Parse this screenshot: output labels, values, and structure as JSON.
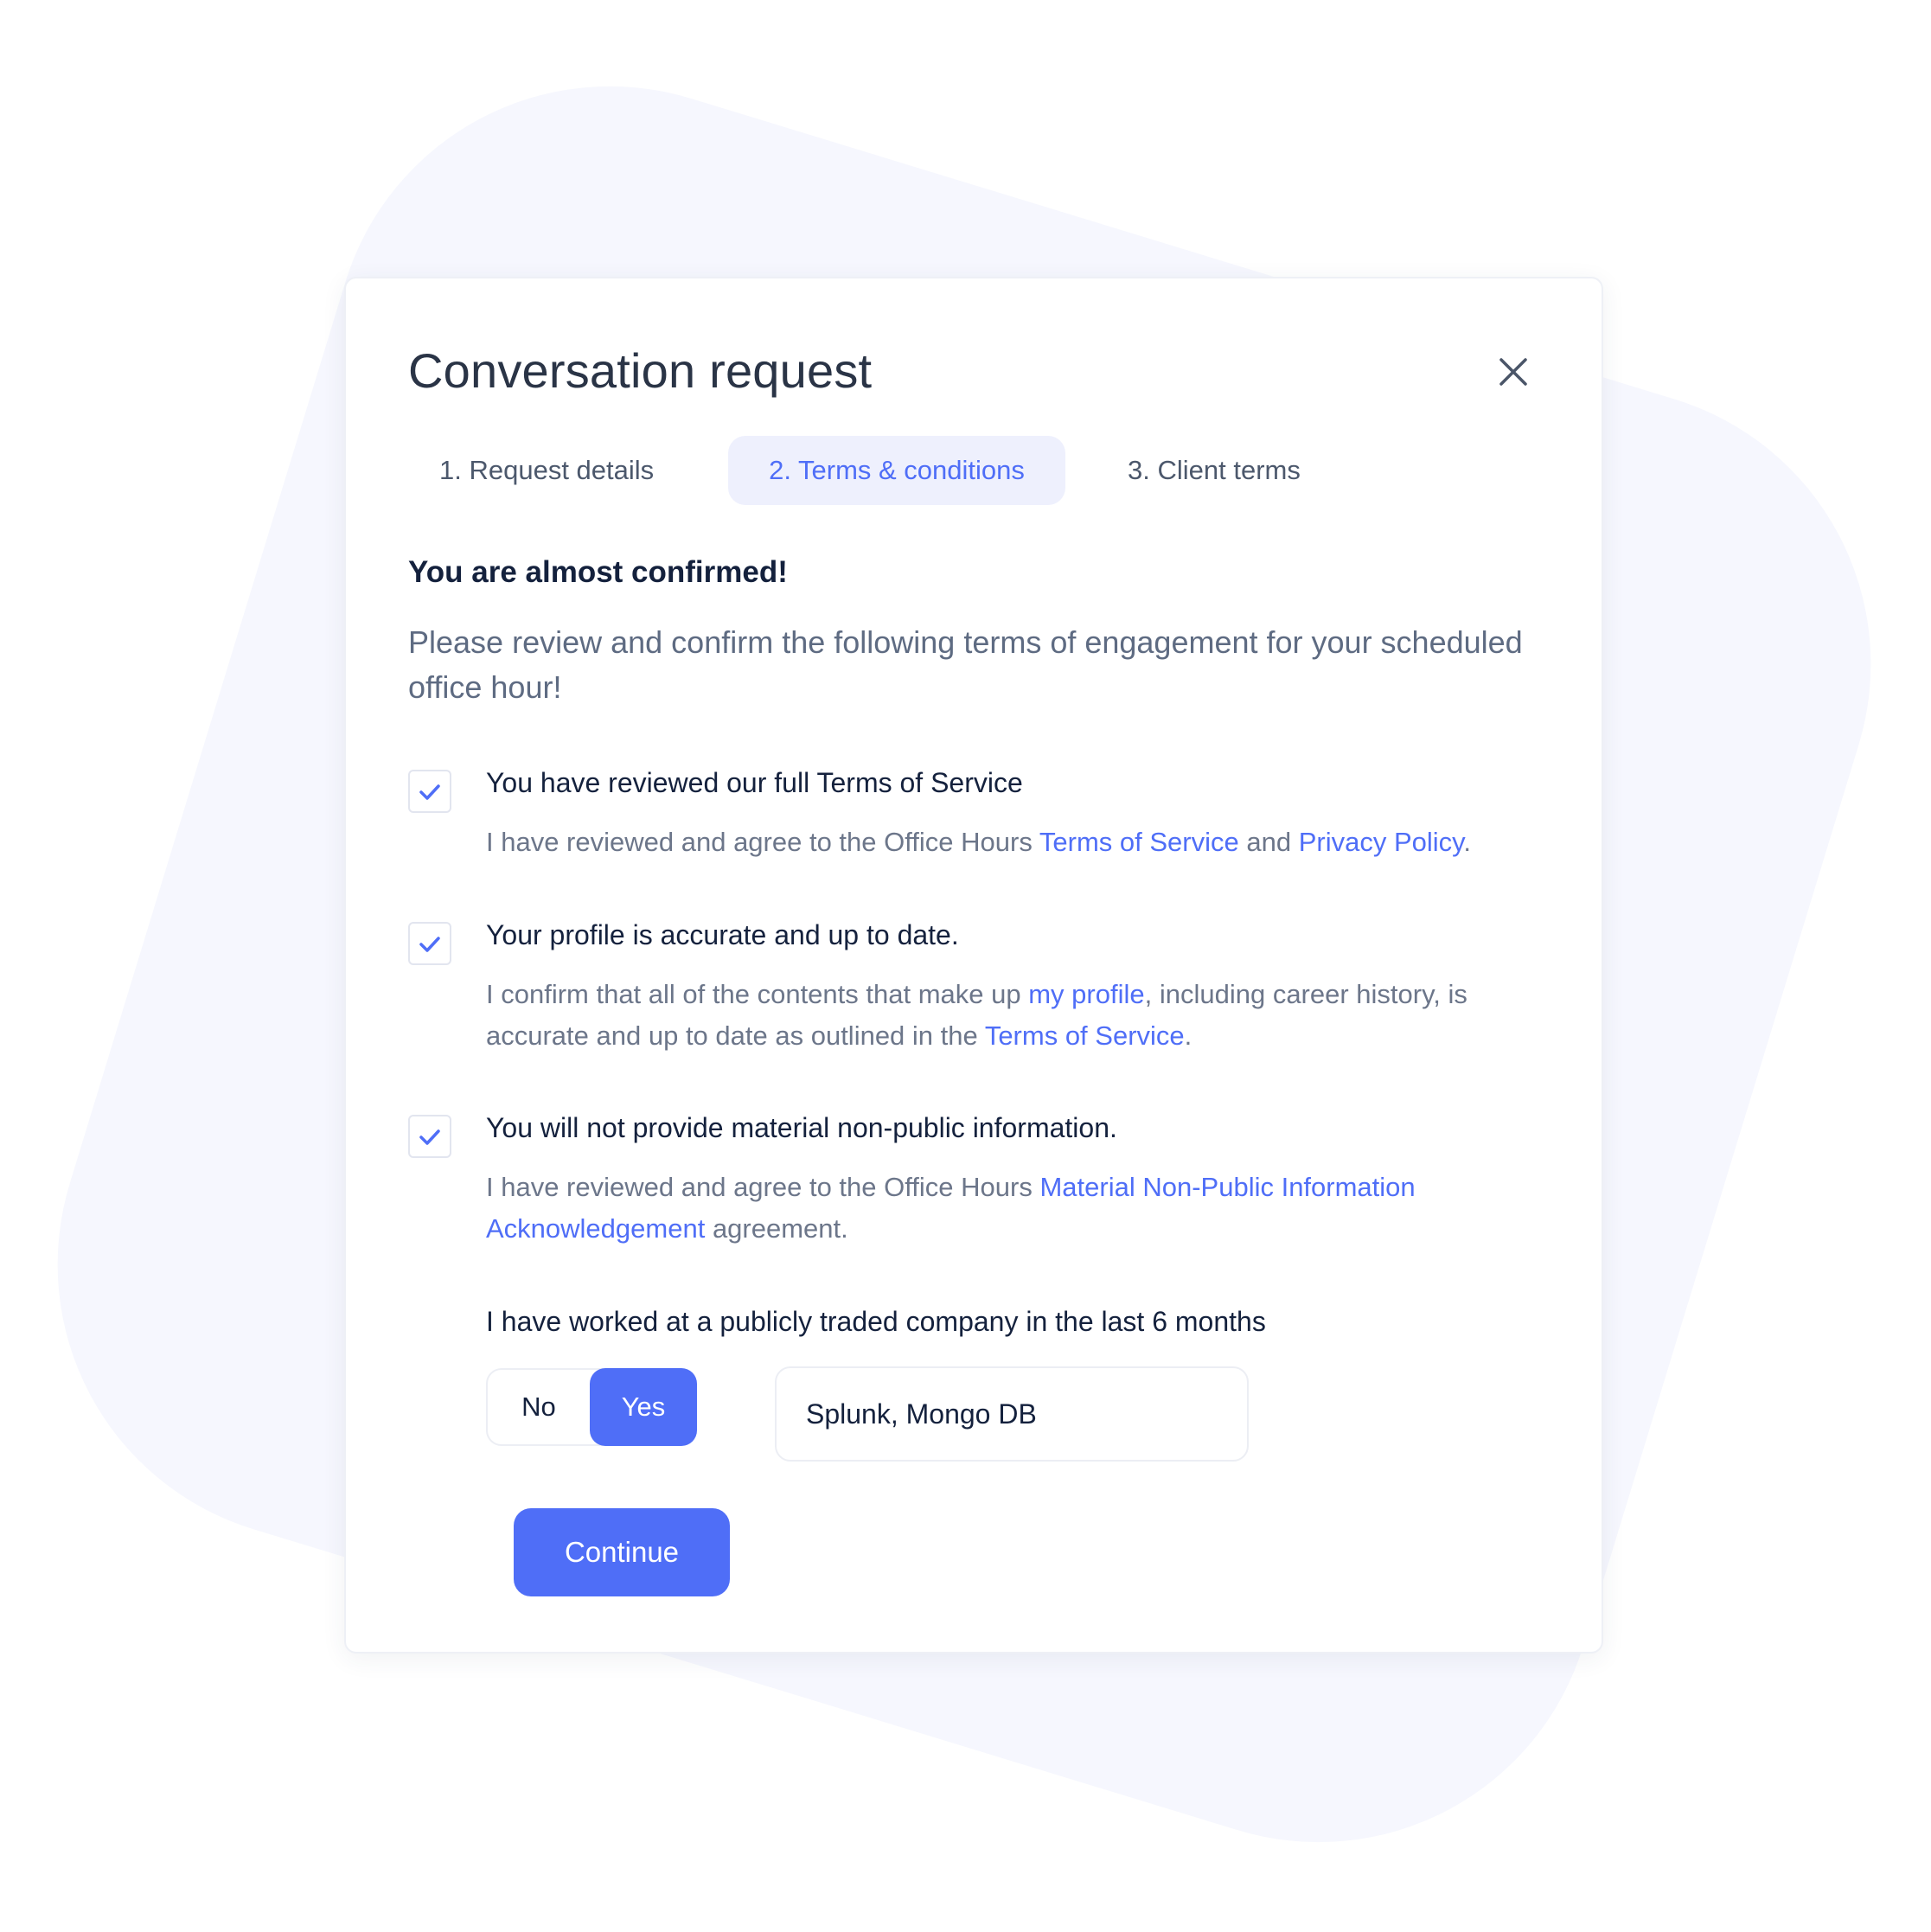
{
  "modal": {
    "title": "Conversation request",
    "close_icon": "close-icon"
  },
  "tabs": [
    {
      "label": "1. Request details",
      "active": false
    },
    {
      "label": "2. Terms & conditions",
      "active": true
    },
    {
      "label": "3. Client terms",
      "active": false
    }
  ],
  "content": {
    "subheading": "You are almost confirmed!",
    "intro": "Please review and confirm the following terms of engagement for your scheduled office hour!"
  },
  "terms": [
    {
      "checked": true,
      "title": "You have reviewed our full Terms of Service",
      "desc_parts": [
        "I have reviewed and agree to the Office Hours ",
        " and ",
        "."
      ],
      "links": [
        "Terms of Service",
        "Privacy Policy"
      ]
    },
    {
      "checked": true,
      "title": "Your profile is accurate and up to date.",
      "desc_parts": [
        "I confirm that all of the contents that make up ",
        ", including career history, is accurate and up to date as outlined in the ",
        "."
      ],
      "links": [
        "my profile",
        "Terms of Service"
      ]
    },
    {
      "checked": true,
      "title": "You will not provide material non-public information.",
      "desc_parts": [
        "I have reviewed and agree to the Office Hours ",
        " agreement."
      ],
      "links": [
        "Material Non-Public Information Acknowledgement"
      ]
    }
  ],
  "public_company": {
    "question": "I have worked at a publicly traded company in the last 6 months",
    "toggle": {
      "no_label": "No",
      "yes_label": "Yes",
      "selected": "Yes"
    },
    "companies_value": "Splunk, Mongo DB"
  },
  "actions": {
    "continue_label": "Continue"
  },
  "colors": {
    "accent": "#4f6ef7",
    "active_tab_bg": "#eef0fd",
    "background_shape": "#f6f7fe"
  },
  "icons": {
    "check": "check-icon",
    "close": "close-icon"
  }
}
